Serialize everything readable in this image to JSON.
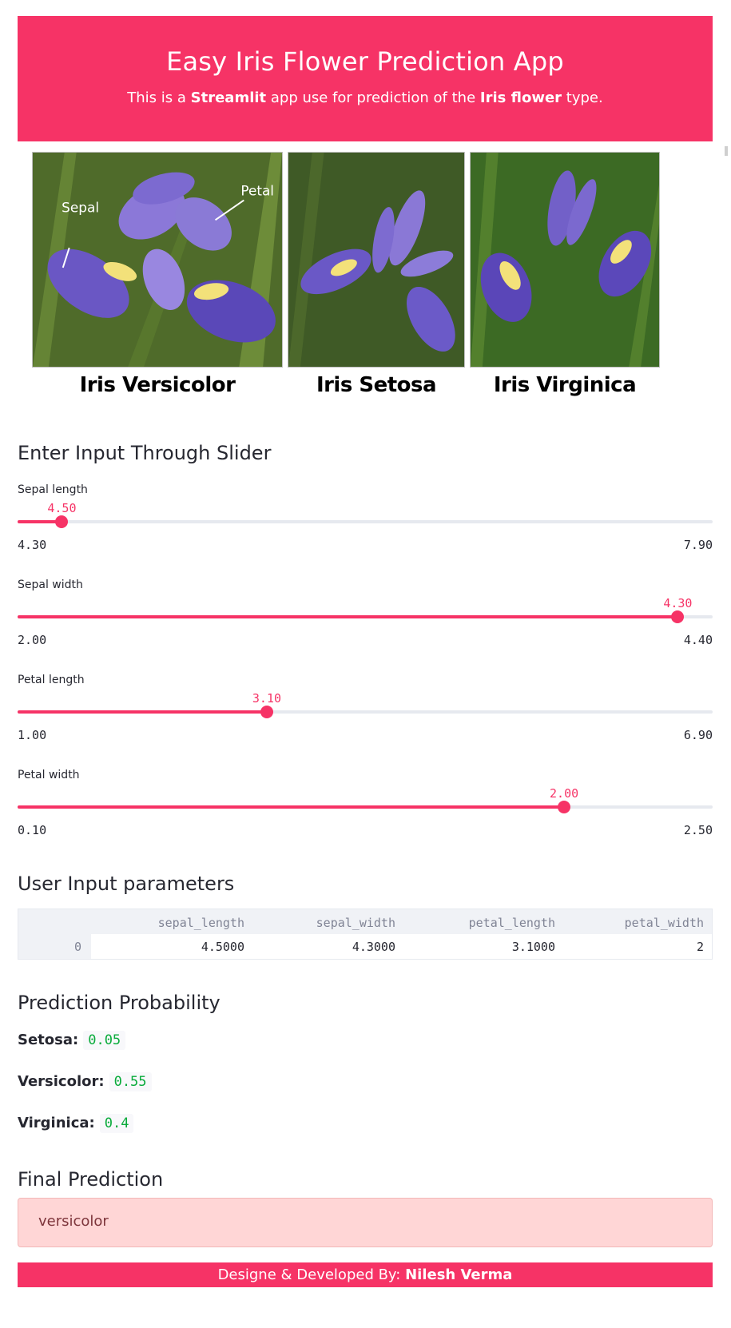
{
  "header": {
    "title": "Easy Iris Flower Prediction App",
    "subtitle_prefix": "This is a ",
    "subtitle_bold_1": "Streamlit",
    "subtitle_middle": " app use for prediction of the ",
    "subtitle_bold_2": "Iris flower",
    "subtitle_suffix": " type."
  },
  "flowers": {
    "photo_labels": {
      "sepal": "Sepal",
      "petal": "Petal"
    },
    "captions": [
      "Iris Versicolor",
      "Iris Setosa",
      "Iris Virginica"
    ]
  },
  "sliders_section": {
    "title": "Enter Input Through Slider",
    "sliders": [
      {
        "label": "Sepal length",
        "value": "4.50",
        "min": "4.30",
        "max": "7.90"
      },
      {
        "label": "Sepal width",
        "value": "4.30",
        "min": "2.00",
        "max": "4.40"
      },
      {
        "label": "Petal length",
        "value": "3.10",
        "min": "1.00",
        "max": "6.90"
      },
      {
        "label": "Petal width",
        "value": "2.00",
        "min": "0.10",
        "max": "2.50"
      }
    ]
  },
  "params_section": {
    "title": "User Input parameters",
    "columns": [
      "sepal_length",
      "sepal_width",
      "petal_length",
      "petal_width"
    ],
    "rows": [
      {
        "index": "0",
        "values": [
          "4.5000",
          "4.3000",
          "3.1000",
          "2"
        ]
      }
    ]
  },
  "probability_section": {
    "title": "Prediction Probability",
    "items": [
      {
        "label": "Setosa",
        "value": "0.05"
      },
      {
        "label": "Versicolor",
        "value": "0.55"
      },
      {
        "label": "Virginica",
        "value": "0.4"
      }
    ]
  },
  "final_section": {
    "title": "Final Prediction",
    "result": "versicolor"
  },
  "footer": {
    "prefix": "Designe & Developed By: ",
    "author": "Nilesh Verma"
  },
  "colors": {
    "accent": "#f63366",
    "result_bg": "#ffd6d6",
    "result_text": "#7d353b",
    "code_green": "#09ab3b"
  }
}
